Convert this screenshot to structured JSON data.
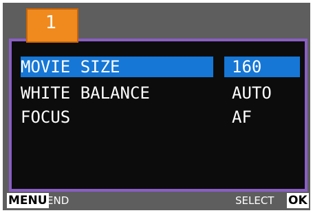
{
  "tab": {
    "number": "1"
  },
  "menu": {
    "items": [
      {
        "label": "MOVIE SIZE",
        "value": "160",
        "selected": true
      },
      {
        "label": "WHITE BALANCE",
        "value": "AUTO",
        "selected": false
      },
      {
        "label": "FOCUS",
        "value": "AF",
        "selected": false
      }
    ]
  },
  "footer": {
    "menu_key": "MENU",
    "menu_action": "END",
    "select_action": "SELECT",
    "ok_key": "OK"
  },
  "colors": {
    "tab_orange": "#f08a1e",
    "panel_border": "#8a5ec4",
    "highlight_blue": "#1677d6",
    "screen_gray": "#5e5e5e"
  }
}
